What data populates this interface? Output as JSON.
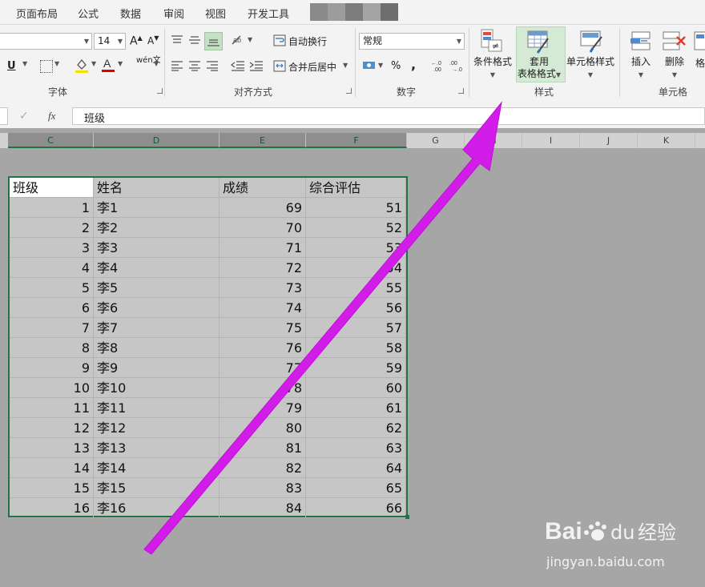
{
  "tabs": [
    "页面布局",
    "公式",
    "数据",
    "审阅",
    "视图",
    "开发工具"
  ],
  "ribbon": {
    "font_size": "14",
    "font_grow_icon": "A^",
    "font_shrink_icon": "Aˇ",
    "underline": "U",
    "phonetic": "wén文",
    "wrap_text": "自动换行",
    "merge_center": "合并后居中",
    "number_format": "常规",
    "percent": "%",
    "comma": ",",
    "cond_format": "条件格式",
    "table_format_1": "套用",
    "table_format_2": "表格格式",
    "cell_style": "单元格样式",
    "insert": "插入",
    "delete": "删除",
    "format_partial": "格",
    "groups": {
      "font": "字体",
      "alignment": "对齐方式",
      "number": "数字",
      "styles": "样式",
      "cells": "单元格"
    }
  },
  "formula_bar": {
    "cancel": "✓",
    "fx": "fx",
    "value": "班级"
  },
  "columns": [
    "C",
    "D",
    "E",
    "F",
    "G",
    "H",
    "I",
    "J",
    "K"
  ],
  "table": {
    "headers": [
      "班级",
      "姓名",
      "成绩",
      "综合评估"
    ],
    "rows": [
      [
        "1",
        "李1",
        "69",
        "51"
      ],
      [
        "2",
        "李2",
        "70",
        "52"
      ],
      [
        "3",
        "李3",
        "71",
        "53"
      ],
      [
        "4",
        "李4",
        "72",
        "54"
      ],
      [
        "5",
        "李5",
        "73",
        "55"
      ],
      [
        "6",
        "李6",
        "74",
        "56"
      ],
      [
        "7",
        "李7",
        "75",
        "57"
      ],
      [
        "8",
        "李8",
        "76",
        "58"
      ],
      [
        "9",
        "李9",
        "77",
        "59"
      ],
      [
        "10",
        "李10",
        "78",
        "60"
      ],
      [
        "11",
        "李11",
        "79",
        "61"
      ],
      [
        "12",
        "李12",
        "80",
        "62"
      ],
      [
        "13",
        "李13",
        "81",
        "63"
      ],
      [
        "14",
        "李14",
        "82",
        "64"
      ],
      [
        "15",
        "李15",
        "83",
        "65"
      ],
      [
        "16",
        "李16",
        "84",
        "66"
      ]
    ]
  },
  "annotation": {
    "arrow_color": "#d21de8"
  },
  "watermark": {
    "brand": "Bai",
    "brand2": "经验",
    "url": "jingyan.baidu.com"
  }
}
